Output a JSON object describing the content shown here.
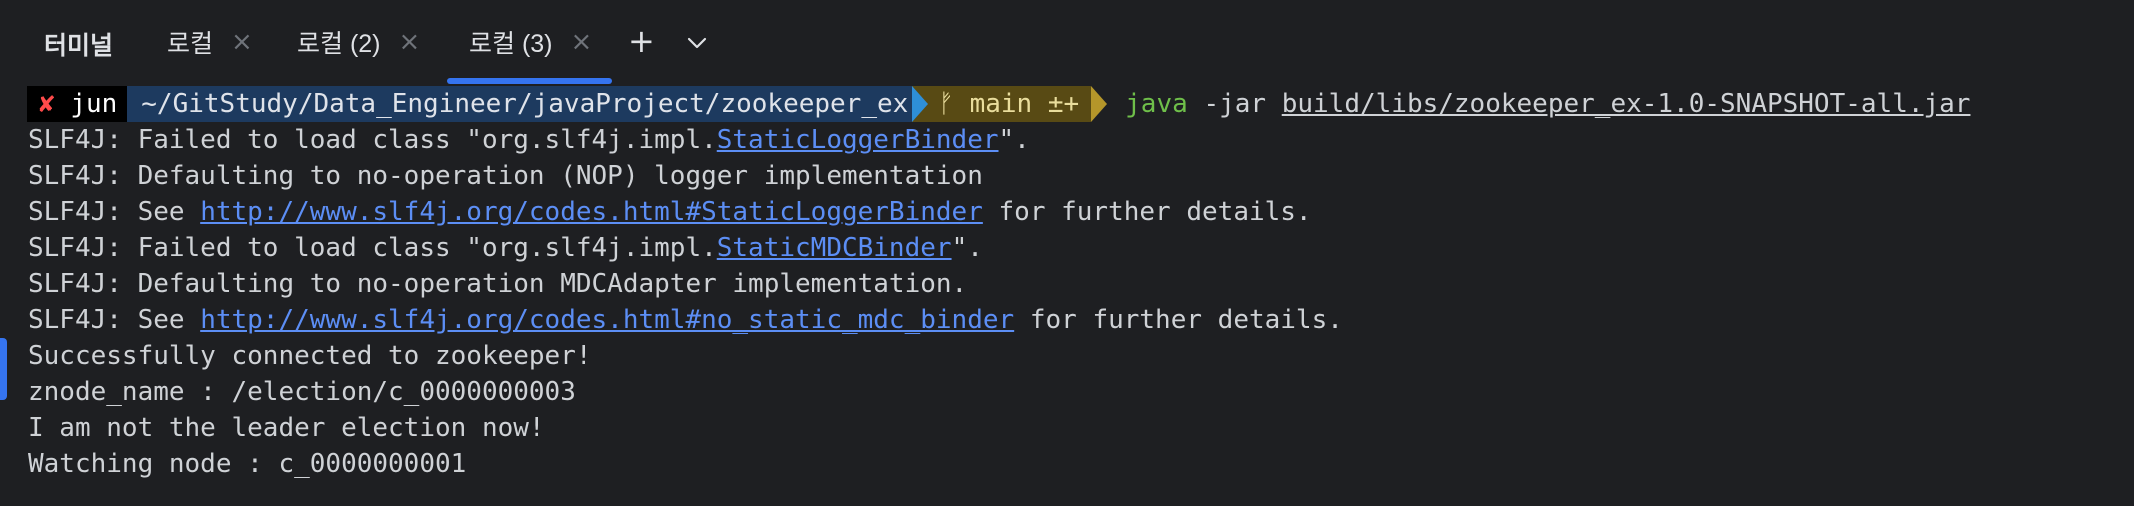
{
  "panel": {
    "title": "터미널"
  },
  "tabs": [
    {
      "label": "로컬",
      "close": "×",
      "active": false
    },
    {
      "label": "로컬 (2)",
      "close": "×",
      "active": false
    },
    {
      "label": "로컬 (3)",
      "close": "×",
      "active": true
    }
  ],
  "tab_actions": {
    "new_tab": "+",
    "dropdown": "⌵"
  },
  "prompt": {
    "status_symbol": "✘",
    "user": "jun",
    "directory": "~/GitStudy/Data_Engineer/javaProject/zookeeper_ex",
    "git_branch_symbol": "ᚠ",
    "git_branch": "main",
    "git_status": "±+",
    "command": "java",
    "flag": "-jar",
    "jar_path": "build/libs/zookeeper_ex-1.0-SNAPSHOT-all.jar"
  },
  "output": {
    "l1_pre": "SLF4J: Failed to load class \"org.slf4j.impl.",
    "l1_link": "StaticLoggerBinder",
    "l1_post": "\".",
    "l2": "SLF4J: Defaulting to no-operation (NOP) logger implementation",
    "l3_pre": "SLF4J: See ",
    "l3_link": "http://www.slf4j.org/codes.html#StaticLoggerBinder",
    "l3_post": " for further details.",
    "l4_pre": "SLF4J: Failed to load class \"org.slf4j.impl.",
    "l4_link": "StaticMDCBinder",
    "l4_post": "\".",
    "l5": "SLF4J: Defaulting to no-operation MDCAdapter implementation.",
    "l6_pre": "SLF4J: See ",
    "l6_link": "http://www.slf4j.org/codes.html#no_static_mdc_binder",
    "l6_post": " for further details.",
    "l7": "Successfully connected to zookeeper!",
    "l8": "znode_name : /election/c_0000000003",
    "l9": "I am not the leader election now!",
    "l10": "Watching node : c_0000000001"
  },
  "colors": {
    "background": "#1e1f22",
    "accent": "#3574f0",
    "link": "#5c8ef5",
    "command": "#6fbf4a",
    "error_mark": "#ff4b4b"
  }
}
